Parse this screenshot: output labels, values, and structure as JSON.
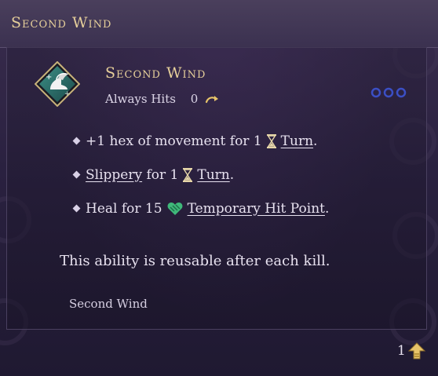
{
  "tooltip": {
    "header_title": "Second Wind",
    "ability": {
      "icon": "winged-boot-icon",
      "name": "Second Wind",
      "accuracy": "Always Hits",
      "cost": "0",
      "cost_icon": "bonus-action-swirl-icon",
      "slots_icon": "three-rings-icon"
    },
    "effects": [
      {
        "prefix": "+1 hex of movement for 1",
        "icon": "hourglass-icon",
        "link": "Turn",
        "suffix": "."
      },
      {
        "link_first": "Slippery",
        "middle": "for 1",
        "icon": "hourglass-icon",
        "link": "Turn",
        "suffix": "."
      },
      {
        "prefix": "Heal for 15",
        "icon": "temporary-hp-heart-icon",
        "link": "Temporary Hit Point",
        "suffix": "."
      }
    ],
    "description": "This ability is reusable after each kill.",
    "source": "Second Wind",
    "footer": {
      "count": "1",
      "icon": "level-up-arrow-icon"
    }
  },
  "colors": {
    "gold_title": "#e6cf9a",
    "text": "#e8e2f0",
    "accent_blue": "#3b4fc4",
    "temp_hp_green": "#3fb87a",
    "arrow_gold": "#e8c46a"
  }
}
